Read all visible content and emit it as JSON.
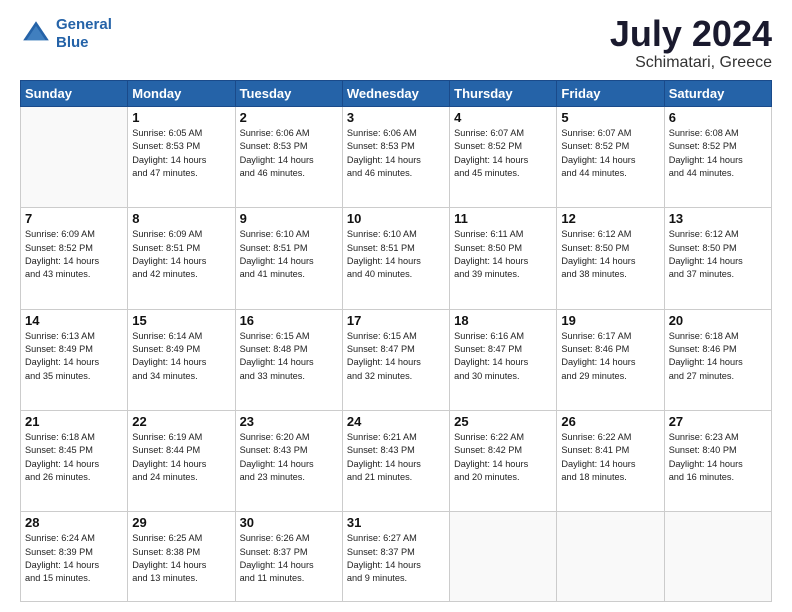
{
  "header": {
    "logo_line1": "General",
    "logo_line2": "Blue",
    "month_year": "July 2024",
    "location": "Schimatari, Greece"
  },
  "days_of_week": [
    "Sunday",
    "Monday",
    "Tuesday",
    "Wednesday",
    "Thursday",
    "Friday",
    "Saturday"
  ],
  "weeks": [
    [
      {
        "day": "",
        "info": ""
      },
      {
        "day": "1",
        "info": "Sunrise: 6:05 AM\nSunset: 8:53 PM\nDaylight: 14 hours\nand 47 minutes."
      },
      {
        "day": "2",
        "info": "Sunrise: 6:06 AM\nSunset: 8:53 PM\nDaylight: 14 hours\nand 46 minutes."
      },
      {
        "day": "3",
        "info": "Sunrise: 6:06 AM\nSunset: 8:53 PM\nDaylight: 14 hours\nand 46 minutes."
      },
      {
        "day": "4",
        "info": "Sunrise: 6:07 AM\nSunset: 8:52 PM\nDaylight: 14 hours\nand 45 minutes."
      },
      {
        "day": "5",
        "info": "Sunrise: 6:07 AM\nSunset: 8:52 PM\nDaylight: 14 hours\nand 44 minutes."
      },
      {
        "day": "6",
        "info": "Sunrise: 6:08 AM\nSunset: 8:52 PM\nDaylight: 14 hours\nand 44 minutes."
      }
    ],
    [
      {
        "day": "7",
        "info": "Sunrise: 6:09 AM\nSunset: 8:52 PM\nDaylight: 14 hours\nand 43 minutes."
      },
      {
        "day": "8",
        "info": "Sunrise: 6:09 AM\nSunset: 8:51 PM\nDaylight: 14 hours\nand 42 minutes."
      },
      {
        "day": "9",
        "info": "Sunrise: 6:10 AM\nSunset: 8:51 PM\nDaylight: 14 hours\nand 41 minutes."
      },
      {
        "day": "10",
        "info": "Sunrise: 6:10 AM\nSunset: 8:51 PM\nDaylight: 14 hours\nand 40 minutes."
      },
      {
        "day": "11",
        "info": "Sunrise: 6:11 AM\nSunset: 8:50 PM\nDaylight: 14 hours\nand 39 minutes."
      },
      {
        "day": "12",
        "info": "Sunrise: 6:12 AM\nSunset: 8:50 PM\nDaylight: 14 hours\nand 38 minutes."
      },
      {
        "day": "13",
        "info": "Sunrise: 6:12 AM\nSunset: 8:50 PM\nDaylight: 14 hours\nand 37 minutes."
      }
    ],
    [
      {
        "day": "14",
        "info": "Sunrise: 6:13 AM\nSunset: 8:49 PM\nDaylight: 14 hours\nand 35 minutes."
      },
      {
        "day": "15",
        "info": "Sunrise: 6:14 AM\nSunset: 8:49 PM\nDaylight: 14 hours\nand 34 minutes."
      },
      {
        "day": "16",
        "info": "Sunrise: 6:15 AM\nSunset: 8:48 PM\nDaylight: 14 hours\nand 33 minutes."
      },
      {
        "day": "17",
        "info": "Sunrise: 6:15 AM\nSunset: 8:47 PM\nDaylight: 14 hours\nand 32 minutes."
      },
      {
        "day": "18",
        "info": "Sunrise: 6:16 AM\nSunset: 8:47 PM\nDaylight: 14 hours\nand 30 minutes."
      },
      {
        "day": "19",
        "info": "Sunrise: 6:17 AM\nSunset: 8:46 PM\nDaylight: 14 hours\nand 29 minutes."
      },
      {
        "day": "20",
        "info": "Sunrise: 6:18 AM\nSunset: 8:46 PM\nDaylight: 14 hours\nand 27 minutes."
      }
    ],
    [
      {
        "day": "21",
        "info": "Sunrise: 6:18 AM\nSunset: 8:45 PM\nDaylight: 14 hours\nand 26 minutes."
      },
      {
        "day": "22",
        "info": "Sunrise: 6:19 AM\nSunset: 8:44 PM\nDaylight: 14 hours\nand 24 minutes."
      },
      {
        "day": "23",
        "info": "Sunrise: 6:20 AM\nSunset: 8:43 PM\nDaylight: 14 hours\nand 23 minutes."
      },
      {
        "day": "24",
        "info": "Sunrise: 6:21 AM\nSunset: 8:43 PM\nDaylight: 14 hours\nand 21 minutes."
      },
      {
        "day": "25",
        "info": "Sunrise: 6:22 AM\nSunset: 8:42 PM\nDaylight: 14 hours\nand 20 minutes."
      },
      {
        "day": "26",
        "info": "Sunrise: 6:22 AM\nSunset: 8:41 PM\nDaylight: 14 hours\nand 18 minutes."
      },
      {
        "day": "27",
        "info": "Sunrise: 6:23 AM\nSunset: 8:40 PM\nDaylight: 14 hours\nand 16 minutes."
      }
    ],
    [
      {
        "day": "28",
        "info": "Sunrise: 6:24 AM\nSunset: 8:39 PM\nDaylight: 14 hours\nand 15 minutes."
      },
      {
        "day": "29",
        "info": "Sunrise: 6:25 AM\nSunset: 8:38 PM\nDaylight: 14 hours\nand 13 minutes."
      },
      {
        "day": "30",
        "info": "Sunrise: 6:26 AM\nSunset: 8:37 PM\nDaylight: 14 hours\nand 11 minutes."
      },
      {
        "day": "31",
        "info": "Sunrise: 6:27 AM\nSunset: 8:37 PM\nDaylight: 14 hours\nand 9 minutes."
      },
      {
        "day": "",
        "info": ""
      },
      {
        "day": "",
        "info": ""
      },
      {
        "day": "",
        "info": ""
      }
    ]
  ]
}
